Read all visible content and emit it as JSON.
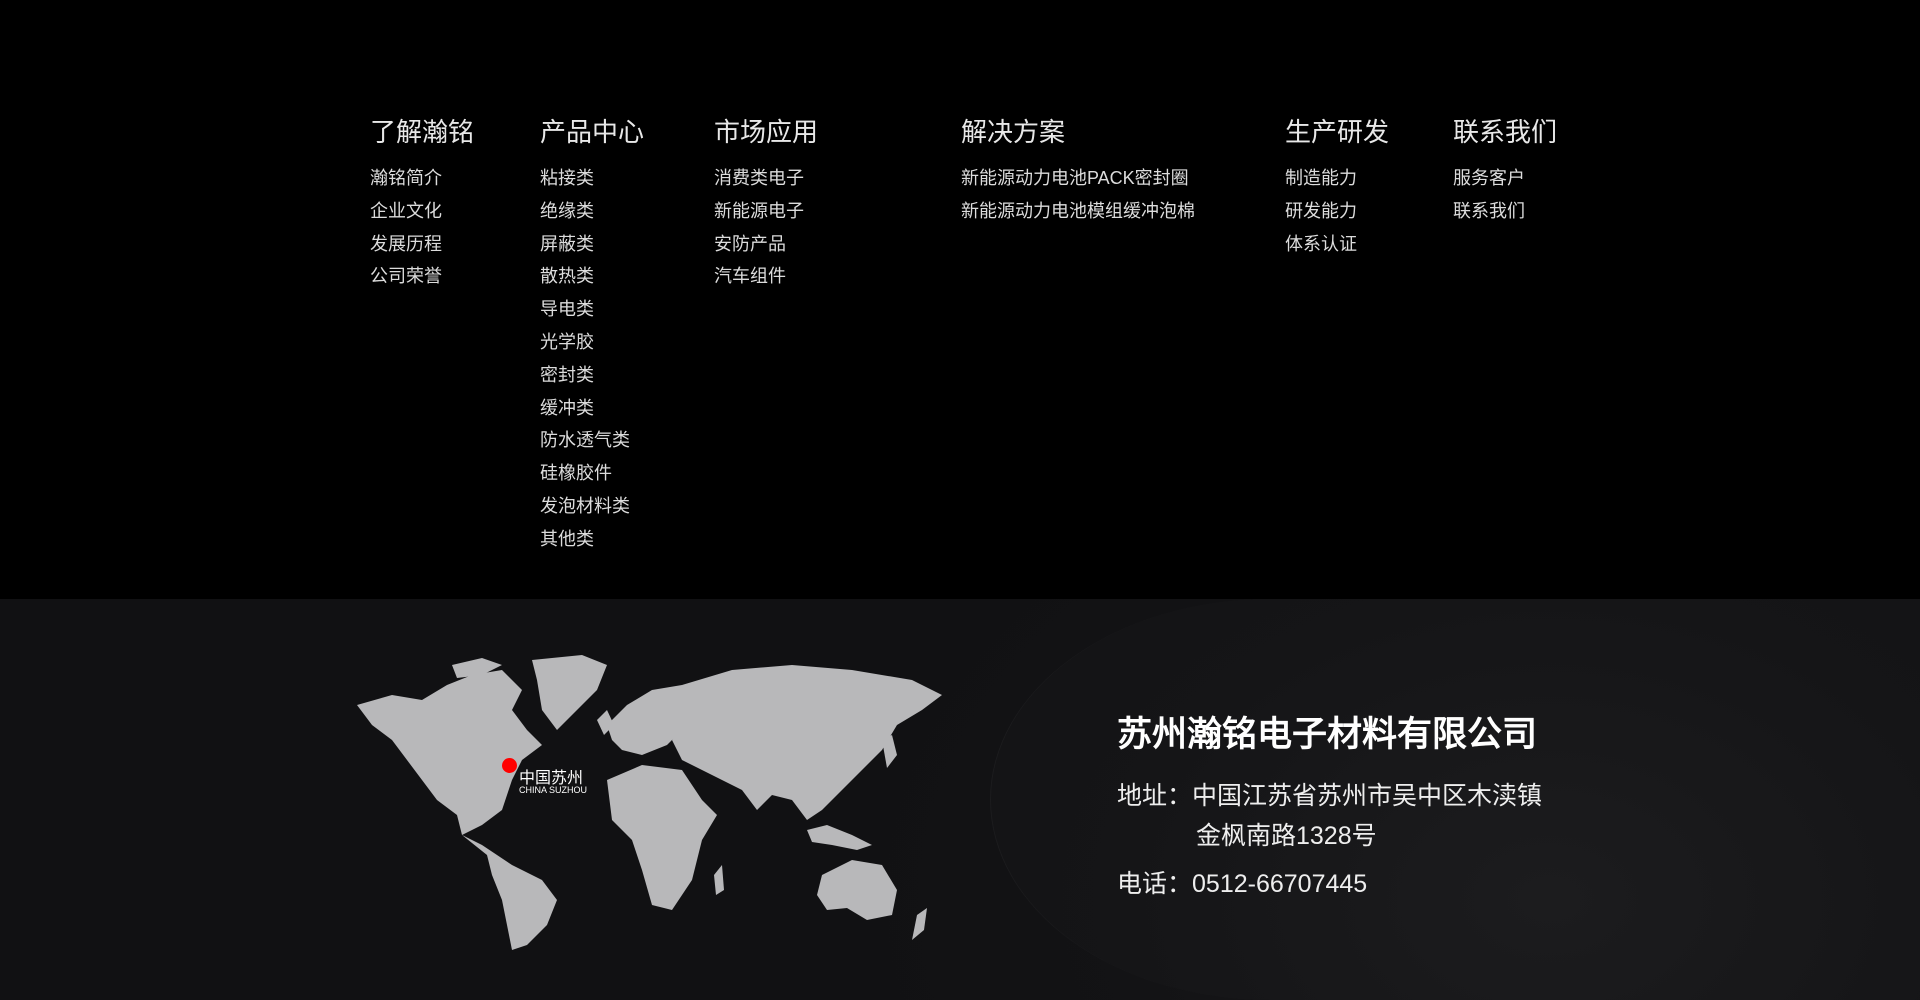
{
  "nav": [
    {
      "title": "了解瀚铭",
      "items": [
        "瀚铭简介",
        "企业文化",
        "发展历程",
        "公司荣誉"
      ]
    },
    {
      "title": "产品中心",
      "items": [
        "粘接类",
        "绝缘类",
        "屏蔽类",
        "散热类",
        "导电类",
        "光学胶",
        "密封类",
        "缓冲类",
        "防水透气类",
        "硅橡胶件",
        "发泡材料类",
        "其他类"
      ]
    },
    {
      "title": "市场应用",
      "items": [
        "消费类电子",
        "新能源电子",
        "安防产品",
        "汽车组件"
      ]
    },
    {
      "title": "解决方案",
      "items": [
        "新能源动力电池PACK密封圈",
        "新能源动力电池模组缓冲泡棉"
      ]
    },
    {
      "title": "生产研发",
      "items": [
        "制造能力",
        "研发能力",
        "体系认证"
      ]
    },
    {
      "title": "联系我们",
      "items": [
        "服务客户",
        "联系我们"
      ]
    }
  ],
  "map": {
    "pin_label_cn": "中国苏州",
    "pin_label_en": "CHINA SUZHOU",
    "pin_color": "#ff0000",
    "land_color": "#b8b8ba"
  },
  "contact": {
    "company": "苏州瀚铭电子材料有限公司",
    "address_label": "地址：",
    "address_line1": "中国江苏省苏州市吴中区木渎镇",
    "address_line2": "金枫南路1328号",
    "phone_label": "电话：",
    "phone": "0512-66707445"
  }
}
